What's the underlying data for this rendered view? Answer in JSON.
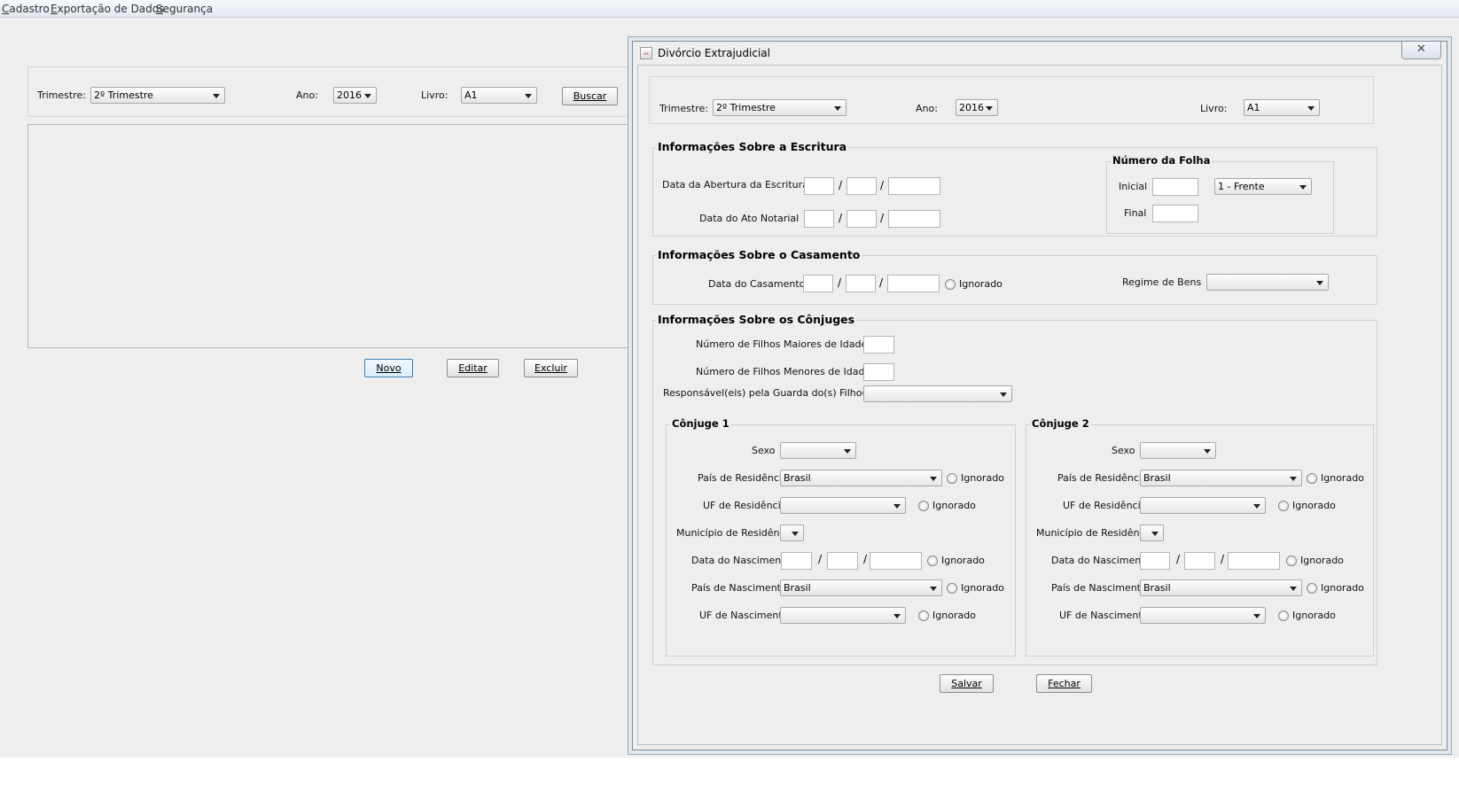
{
  "menubar": {
    "items": [
      {
        "prefix": "",
        "mnemonic": "C",
        "rest": "adastro"
      },
      {
        "prefix": "",
        "mnemonic": "E",
        "rest": "xportação de Dados"
      },
      {
        "prefix": "",
        "mnemonic": "S",
        "rest": "egurança"
      }
    ]
  },
  "main": {
    "trimestre_label": "Trimestre:",
    "trimestre_value": "2º Trimestre",
    "ano_label": "Ano:",
    "ano_value": "2016",
    "livro_label": "Livro:",
    "livro_value": "A1",
    "buscar_label": "Buscar",
    "novo_label": "Novo",
    "editar_label": "Editar",
    "excluir_label": "Excluir"
  },
  "dialog": {
    "title": "Divórcio Extrajudicial",
    "close_glyph": "✕",
    "trimestre_label": "Trimestre:",
    "trimestre_value": "2º Trimestre",
    "ano_label": "Ano:",
    "ano_value": "2016",
    "livro_label": "Livro:",
    "livro_value": "A1",
    "escritura": {
      "title": "Informações Sobre a Escritura",
      "abertura_label": "Data da Abertura da Escritura",
      "ato_label": "Data do Ato Notarial",
      "date_sep": "/",
      "folha_title": "Número da Folha",
      "inicial_label": "Inicial",
      "final_label": "Final",
      "lado_value": "1 - Frente"
    },
    "casamento": {
      "title": "Informações Sobre o Casamento",
      "data_label": "Data do Casamento",
      "ignorado_label": "Ignorado",
      "regime_label": "Regime de Bens",
      "regime_value": ""
    },
    "conjuges": {
      "title": "Informações Sobre os Cônjuges",
      "maiores_label": "Número de Filhos Maiores de Idade",
      "menores_label": "Número de Filhos Menores de Idade",
      "guarda_label": "Responsável(eis) pela Guarda do(s) Filho(s)",
      "guarda_value": "",
      "conjuge1": {
        "title": "Cônjuge 1",
        "sexo_label": "Sexo",
        "pais_res_label": "País de Residência",
        "pais_res_value": "Brasil",
        "uf_res_label": "UF de Residência",
        "mun_res_label": "Município de Residência",
        "nasc_label": "Data do Nascimento",
        "pais_nasc_label": "País de Nascimento",
        "pais_nasc_value": "Brasil",
        "uf_nasc_label": "UF de Nascimento",
        "ignorado_label": "Ignorado"
      },
      "conjuge2": {
        "title": "Cônjuge 2",
        "sexo_label": "Sexo",
        "pais_res_label": "País de Residência",
        "pais_res_value": "Brasil",
        "uf_res_label": "UF de Residência",
        "mun_res_label": "Município de Residência",
        "nasc_label": "Data do Nascimento",
        "pais_nasc_label": "País de Nascimento",
        "pais_nasc_value": "Brasil",
        "uf_nasc_label": "UF de Nascimento",
        "ignorado_label": "Ignorado"
      }
    },
    "salvar_label": "Salvar",
    "fechar_label": "Fechar"
  }
}
